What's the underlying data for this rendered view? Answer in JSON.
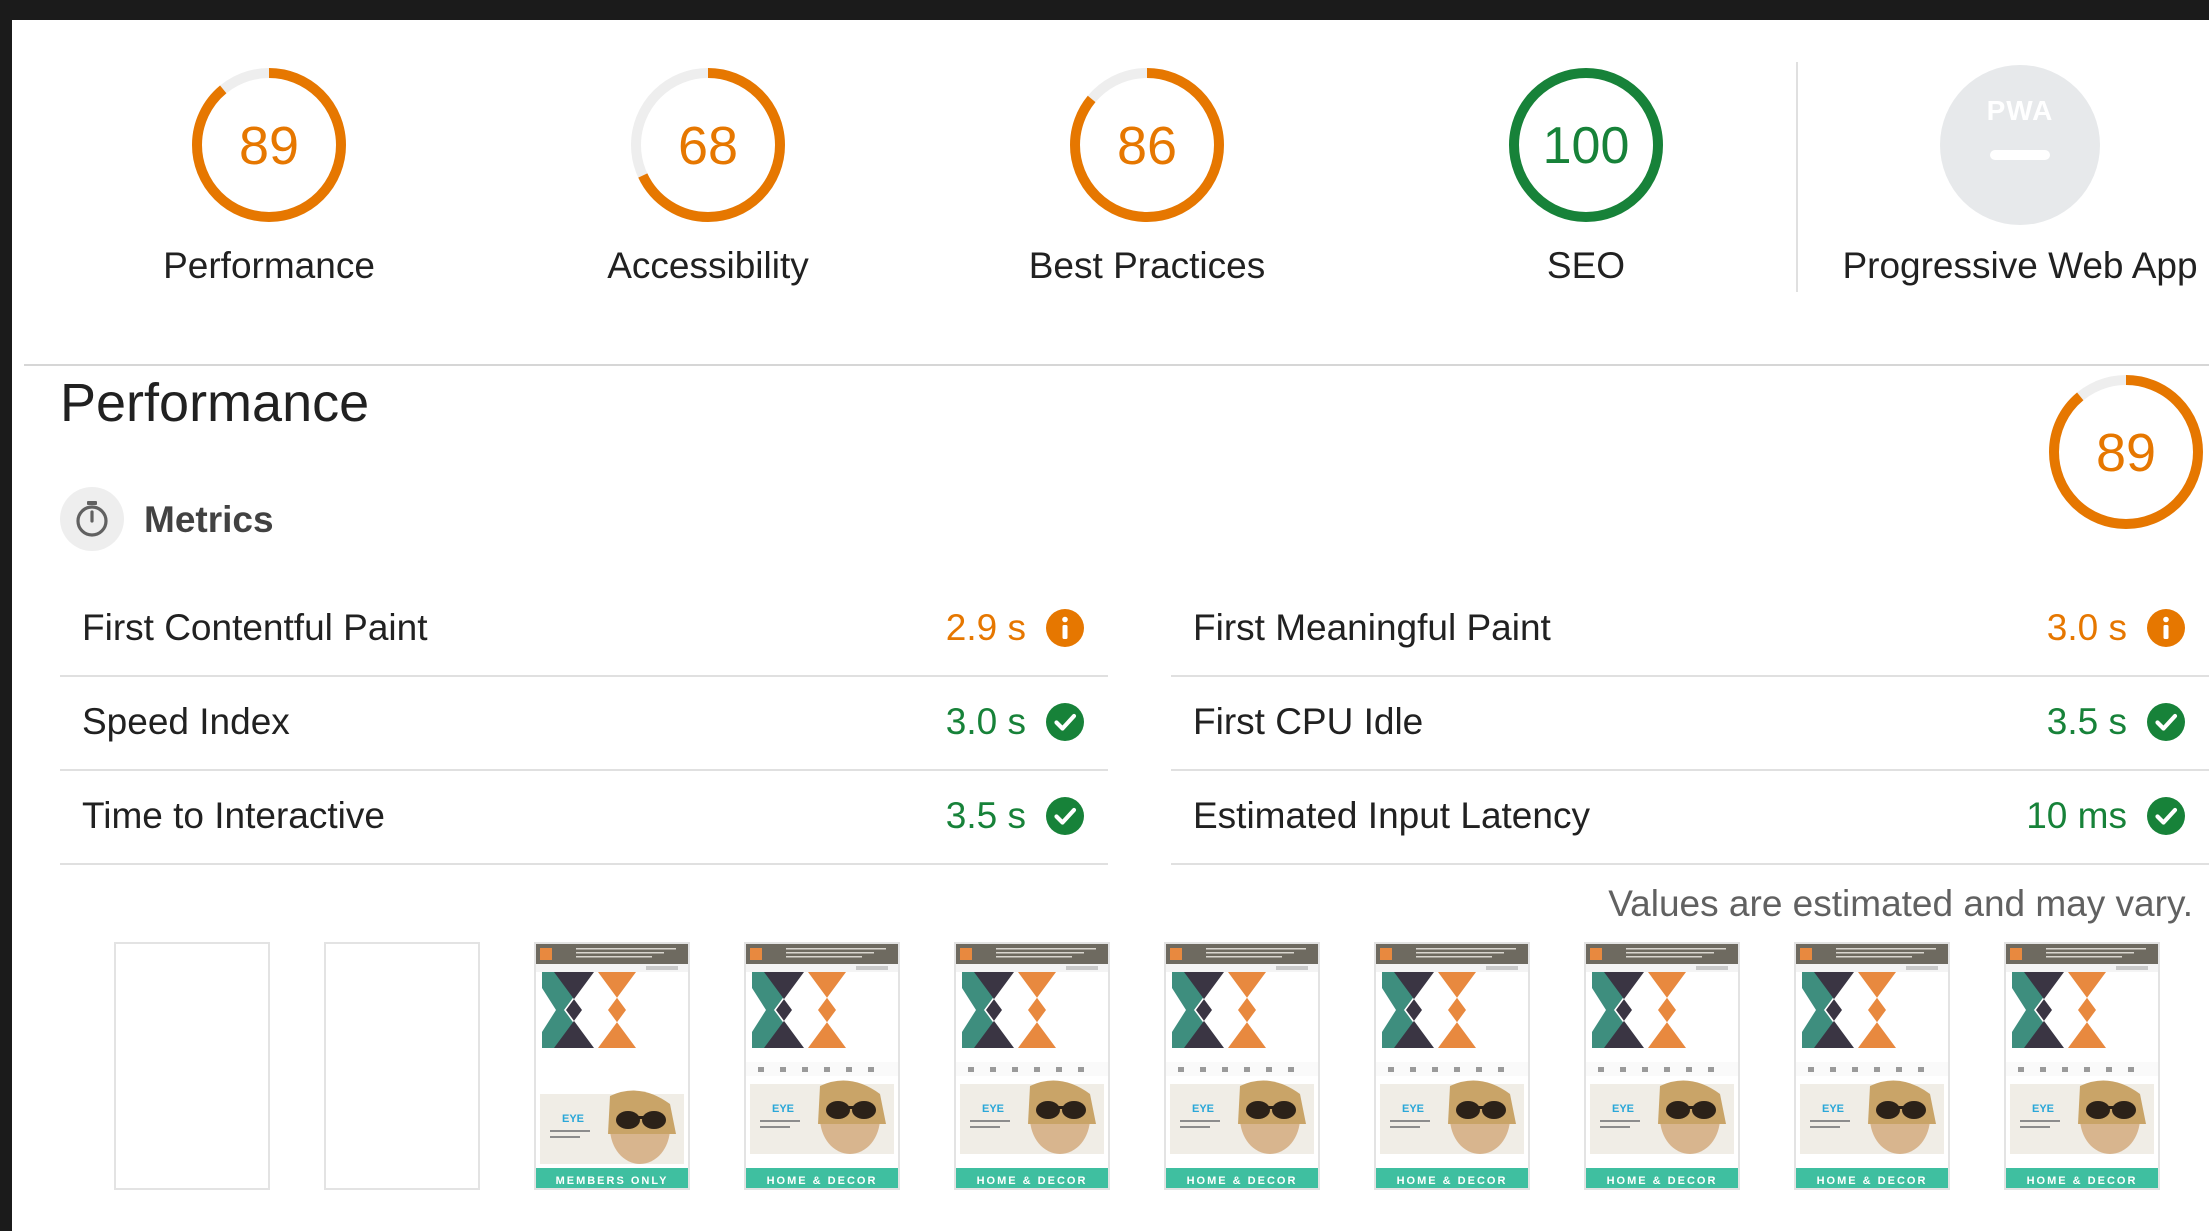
{
  "categories": [
    {
      "label": "Performance",
      "score": "89",
      "status": "average",
      "fraction": 0.89
    },
    {
      "label": "Accessibility",
      "score": "68",
      "status": "average",
      "fraction": 0.68
    },
    {
      "label": "Best Practices",
      "score": "86",
      "status": "average",
      "fraction": 0.86
    },
    {
      "label": "SEO",
      "score": "100",
      "status": "pass",
      "fraction": 1.0
    },
    {
      "label": "Progressive Web App",
      "badge_text": "PWA",
      "status": "na"
    }
  ],
  "performance": {
    "title": "Performance",
    "score": "89",
    "fraction": 0.89,
    "metrics_title": "Metrics",
    "metrics_icon": "stopwatch-icon",
    "metrics": [
      {
        "name": "First Contentful Paint",
        "value": "2.9 s",
        "status": "average"
      },
      {
        "name": "First Meaningful Paint",
        "value": "3.0 s",
        "status": "average"
      },
      {
        "name": "Speed Index",
        "value": "3.0 s",
        "status": "pass"
      },
      {
        "name": "First CPU Idle",
        "value": "3.5 s",
        "status": "pass"
      },
      {
        "name": "Time to Interactive",
        "value": "3.5 s",
        "status": "pass"
      },
      {
        "name": "Estimated Input Latency",
        "value": "10 ms",
        "status": "pass"
      }
    ],
    "disclaimer": "Values are estimated and may vary."
  },
  "filmstrip": {
    "frames": [
      {
        "state": "blank"
      },
      {
        "state": "blank"
      },
      {
        "state": "loaded",
        "banner_text": "MEMBERS ONLY",
        "promo_text": "EYE"
      },
      {
        "state": "loaded",
        "banner_text": "HOME & DECOR",
        "promo_text": "EYE"
      },
      {
        "state": "loaded",
        "banner_text": "HOME & DECOR",
        "promo_text": "EYE"
      },
      {
        "state": "loaded",
        "banner_text": "HOME & DECOR",
        "promo_text": "EYE"
      },
      {
        "state": "loaded",
        "banner_text": "HOME & DECOR",
        "promo_text": "EYE"
      },
      {
        "state": "loaded",
        "banner_text": "HOME & DECOR",
        "promo_text": "EYE"
      },
      {
        "state": "loaded",
        "banner_text": "HOME & DECOR",
        "promo_text": "EYE"
      },
      {
        "state": "loaded",
        "banner_text": "HOME & DECOR",
        "promo_text": "EYE"
      }
    ]
  },
  "colors": {
    "average": "#e67700",
    "pass": "#178239",
    "track_average": "#eeeeee",
    "pwa_badge": "#e7e9eb",
    "banner_teal": "#3fbfa0",
    "chevron_dark": "#3a3543",
    "chevron_orange": "#e8893f",
    "chevron_green": "#3e8e7e"
  }
}
